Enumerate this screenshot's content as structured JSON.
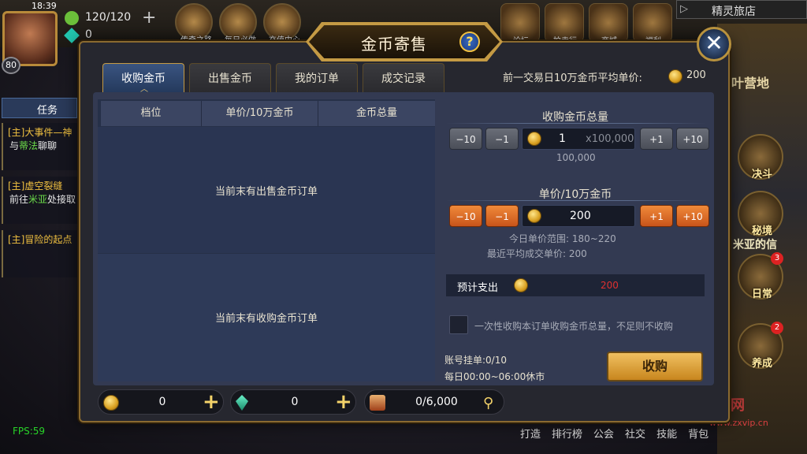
{
  "status": {
    "time": "18:39"
  },
  "player": {
    "level": "80",
    "stamina": "120/120",
    "gems": "0"
  },
  "top_icons": [
    "传奇之路",
    "每日必做",
    "充值中心"
  ],
  "right_top_icons": [
    "论坛",
    "拍卖行",
    "商城",
    "福利"
  ],
  "realm": {
    "name": "精灵旅店"
  },
  "side_buttons": [
    {
      "label": "决斗",
      "badge": ""
    },
    {
      "label": "秘境",
      "badge": ""
    },
    {
      "label": "日常",
      "badge": "3"
    },
    {
      "label": "养成",
      "badge": "2"
    }
  ],
  "side_texts": {
    "camp": "叶营地",
    "green": "米亚的信"
  },
  "quests": {
    "tab": "任务",
    "items": [
      {
        "title": "[主]大事件—神",
        "desc_prefix": "与",
        "desc_highlight": "蒂法",
        "desc_suffix": "聊聊"
      },
      {
        "title": "[主]虚空裂缝",
        "desc_prefix": "前往",
        "desc_highlight": "米亚",
        "desc_suffix": "处接取"
      },
      {
        "title": "[主]冒险的起点",
        "desc_prefix": "",
        "desc_highlight": "",
        "desc_suffix": ""
      }
    ]
  },
  "bottom_nav": [
    "打造",
    "排行榜",
    "公会",
    "社交",
    "技能",
    "背包"
  ],
  "fps": "FPS:59",
  "watermark": {
    "text": "峰哥素材网",
    "url": "www.zxvip.cn"
  },
  "dialog": {
    "title": "金币寄售",
    "help": "?",
    "close": "✕",
    "tabs": [
      "收购金币",
      "出售金币",
      "我的订单",
      "成交记录"
    ],
    "active_tab": 0,
    "avg_label": "前一交易日10万金币平均单价:",
    "avg_value": "200",
    "table": {
      "headers": [
        "档位",
        "单价/10万金币",
        "金币总量"
      ],
      "empty_sell": "当前末有出售金币订单",
      "empty_buy": "当前末有收购金币订单"
    },
    "total": {
      "heading": "收购金币总量",
      "minus10": "−10",
      "minus1": "−1",
      "value": "1",
      "unit": "x100,000",
      "plus1": "+1",
      "plus10": "+10",
      "subtotal": "100,000"
    },
    "price": {
      "heading": "单价/10万金币",
      "minus10": "−10",
      "minus1": "−1",
      "value": "200",
      "plus1": "+1",
      "plus10": "+10",
      "range": "今日单价范围: 180~220",
      "recent": "最近平均成交单价: 200"
    },
    "expense": {
      "label": "预计支出",
      "value": "200"
    },
    "checkbox_label": "一次性收购本订单收购金币总量，不足则不收购",
    "account_orders": "账号挂单:0/10",
    "closed_hours": "每日00:00~06:00休市",
    "buy_button": "收购",
    "currencies": [
      {
        "icon": "gold-coin-icon",
        "value": "0",
        "plus": "+"
      },
      {
        "icon": "gem-icon",
        "value": "0",
        "plus": "+"
      },
      {
        "icon": "scroll-icon",
        "value": "0/6,000"
      }
    ]
  },
  "colors": {
    "accent": "#c49a44",
    "orange_button": "#e8742a",
    "expense_red": "#e03030",
    "fps_green": "#28d428"
  }
}
